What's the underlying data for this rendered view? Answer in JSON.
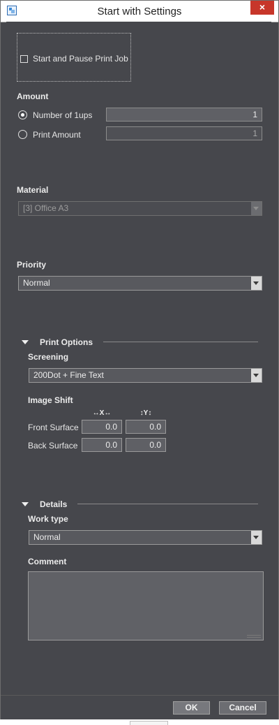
{
  "window": {
    "title": "Start with Settings",
    "close_symbol": "×"
  },
  "start_pause": {
    "label": "Start and Pause Print Job",
    "checked": false
  },
  "amount": {
    "title": "Amount",
    "options": [
      {
        "label": "Number of 1ups",
        "value": "1",
        "selected": true
      },
      {
        "label": "Print Amount",
        "value": "1",
        "selected": false
      }
    ]
  },
  "material": {
    "title": "Material",
    "selected": "[3] Office A3"
  },
  "priority": {
    "title": "Priority",
    "selected": "Normal"
  },
  "print_options": {
    "title": "Print Options",
    "screening": {
      "title": "Screening",
      "selected": "200Dot + Fine Text"
    },
    "image_shift": {
      "title": "Image Shift",
      "x_header": "↔X↔",
      "y_header": "↕Y↕",
      "rows": [
        {
          "label": "Front Surface",
          "x": "0.0",
          "y": "0.0"
        },
        {
          "label": "Back Surface",
          "x": "0.0",
          "y": "0.0"
        }
      ]
    }
  },
  "details": {
    "title": "Details",
    "work_type": {
      "title": "Work type",
      "selected": "Normal"
    },
    "comment": {
      "title": "Comment",
      "value": ""
    }
  },
  "buttons": {
    "ok": "OK",
    "cancel": "Cancel"
  }
}
